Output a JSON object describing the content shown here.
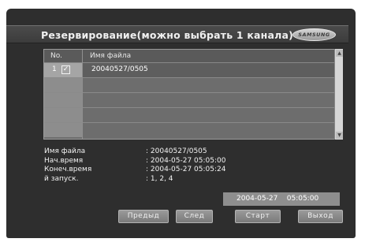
{
  "header": {
    "title": "Резервирование(можно выбрать 1 канала)",
    "logo": "SAMSUNG"
  },
  "table": {
    "columns": {
      "no": "No.",
      "file": "Имя файла"
    },
    "rows": [
      {
        "no": "1",
        "checked": true,
        "file": "20040527/0505"
      }
    ]
  },
  "info": {
    "labels": [
      "Имя файла",
      "Нач.время",
      "Конеч.время",
      "й запуск."
    ],
    "values": [
      ": 20040527/0505",
      ": 2004-05-27 05:05:00",
      ": 2004-05-27 05:05:24",
      ": 1, 2, 4"
    ]
  },
  "clock": "2004-05-27    05:05:00",
  "buttons": {
    "prev": "Предыд",
    "next": "След",
    "start": "Старт",
    "exit": "Выход"
  },
  "colors": {
    "background": "#2e2e2e",
    "table": "#6d6d6d",
    "button": "#8a8a8a"
  }
}
